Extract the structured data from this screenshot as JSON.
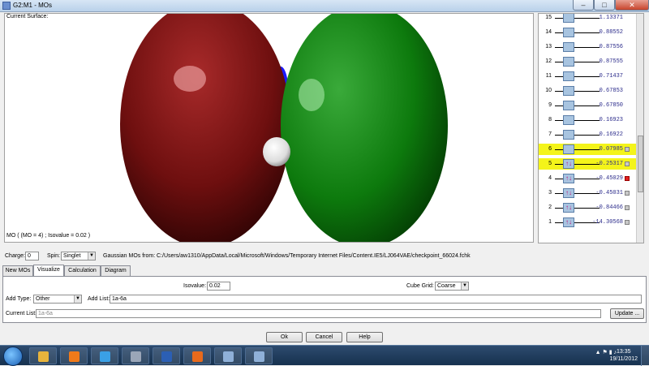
{
  "window": {
    "title": "G2:M1 - MOs",
    "minimize": "–",
    "maximize": "□",
    "close": "✕"
  },
  "viewer": {
    "current_surface_label": "Current Surface:",
    "caption": "MO ( (MO = 4) ; Isovalue = 0.02 )"
  },
  "levels": [
    {
      "num": "15",
      "energy": "1.13371",
      "electrons": "",
      "highlight": false,
      "marker": ""
    },
    {
      "num": "14",
      "energy": "0.88552",
      "electrons": "",
      "highlight": false,
      "marker": ""
    },
    {
      "num": "13",
      "energy": "0.87556",
      "electrons": "",
      "highlight": false,
      "marker": ""
    },
    {
      "num": "12",
      "energy": "0.87555",
      "electrons": "",
      "highlight": false,
      "marker": ""
    },
    {
      "num": "11",
      "energy": "0.71437",
      "electrons": "",
      "highlight": false,
      "marker": ""
    },
    {
      "num": "10",
      "energy": "0.67853",
      "electrons": "",
      "highlight": false,
      "marker": ""
    },
    {
      "num": "9",
      "energy": "0.67850",
      "electrons": "",
      "highlight": false,
      "marker": ""
    },
    {
      "num": "8",
      "energy": "0.16923",
      "electrons": "",
      "highlight": false,
      "marker": ""
    },
    {
      "num": "7",
      "energy": "0.16922",
      "electrons": "",
      "highlight": false,
      "marker": ""
    },
    {
      "num": "6",
      "energy": "0.07985",
      "electrons": "",
      "highlight": true,
      "marker": "grey"
    },
    {
      "num": "5",
      "energy": "-0.25317",
      "electrons": "↑↓",
      "highlight": true,
      "marker": "grey"
    },
    {
      "num": "4",
      "energy": "-0.45029",
      "electrons": "↑↓",
      "highlight": false,
      "marker": "red"
    },
    {
      "num": "3",
      "energy": "-0.45031",
      "electrons": "↑↓",
      "highlight": false,
      "marker": "grey"
    },
    {
      "num": "2",
      "energy": "-0.84466",
      "electrons": "↑↓",
      "highlight": false,
      "marker": "grey"
    },
    {
      "num": "1",
      "energy": "-14.30568",
      "electrons": "↑↓",
      "highlight": false,
      "marker": "grey"
    }
  ],
  "controls": {
    "charge_label": "Charge:",
    "charge_value": "0",
    "spin_label": "Spin:",
    "spin_value": "Singlet",
    "mos_from_label": "Gaussian MOs from:",
    "mos_from_path": "C:/Users/aw1310/AppData/Local/Microsoft/Windows/Temporary Internet Files/Content.IE5/LJ064VAE/checkpoint_66024.fchk"
  },
  "tabs": [
    {
      "label": "New MOs",
      "active": false
    },
    {
      "label": "Visualize",
      "active": true
    },
    {
      "label": "Calculation",
      "active": false
    },
    {
      "label": "Diagram",
      "active": false
    }
  ],
  "visualize": {
    "isovalue_label": "Isovalue:",
    "isovalue_value": "0.02",
    "cube_grid_label": "Cube Grid:",
    "cube_grid_value": "Coarse",
    "add_type_label": "Add Type:",
    "add_type_value": "Other",
    "add_list_label": "Add List:",
    "add_list_value": "1a-6a",
    "current_list_label": "Current List:",
    "current_list_value": "1a-6a",
    "update_button": "Update ..."
  },
  "buttons": {
    "ok": "Ok",
    "cancel": "Cancel",
    "help": "Help"
  },
  "taskbar": {
    "time": "13:35",
    "date": "19/11/2012",
    "apps": [
      {
        "name": "explorer-icon",
        "color": "#e8b43c"
      },
      {
        "name": "media-player-icon",
        "color": "#f07a1a"
      },
      {
        "name": "internet-explorer-icon",
        "color": "#3aa0e6"
      },
      {
        "name": "network-tool-icon",
        "color": "#9aa6b8"
      },
      {
        "name": "word-icon",
        "color": "#2b5fb4"
      },
      {
        "name": "firefox-icon",
        "color": "#e86a1c"
      },
      {
        "name": "gaussview-window-icon",
        "color": "#8fb0d8"
      },
      {
        "name": "gaussview-window-icon-2",
        "color": "#8fb0d8"
      }
    ]
  }
}
